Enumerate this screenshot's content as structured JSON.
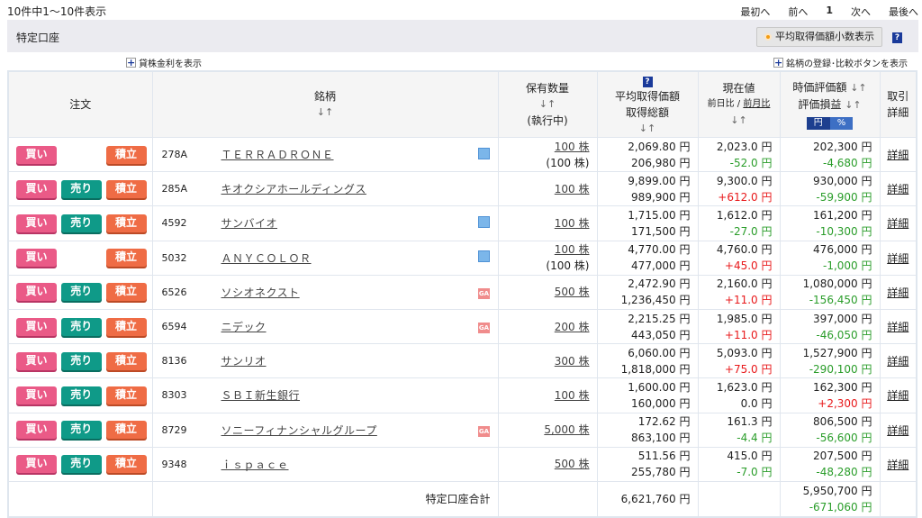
{
  "summary": "10件中1～10件表示",
  "pager": {
    "first": "最初へ",
    "prev": "前へ",
    "page": "1",
    "next": "次へ",
    "last": "最後へ"
  },
  "account_title": "特定口座",
  "avg_decimal_button": "平均取得価額小数表示",
  "help": "?",
  "show_lending": "貸株金利を表示",
  "show_compare": "銘柄の登録･比較ボタンを表示",
  "headers": {
    "order": "注文",
    "name": "銘柄",
    "qty": "保有数量",
    "qty_pending": "(執行中)",
    "avg": "平均取得価額",
    "total_cost": "取得総額",
    "price": "現在値",
    "day": "前日比",
    "month": "前月比",
    "value": "時価評価額",
    "pl": "評価損益",
    "yen": "円",
    "pct": "%",
    "detail1": "取引",
    "detail2": "詳細",
    "sort": "↓↑"
  },
  "buttons": {
    "buy": "買い",
    "sell": "売り",
    "accum": "積立"
  },
  "detail_link": "詳細",
  "rows": [
    {
      "code": "278A",
      "name": "ＴＥＲＲＡＤＲＯＮＥ",
      "icon": "calendar-icon",
      "sell": false,
      "qty": "100 株",
      "pending": "(100 株)",
      "avg": "2,069.80 円",
      "cost": "206,980 円",
      "price": "2,023.0 円",
      "chg": "-52.0 円",
      "value": "202,300 円",
      "pl": "-4,680 円"
    },
    {
      "code": "285A",
      "name": "キオクシアホールディングス",
      "icon": "",
      "sell": true,
      "qty": "100 株",
      "pending": "",
      "avg": "9,899.00 円",
      "cost": "989,900 円",
      "price": "9,300.0 円",
      "chg": "+612.0 円",
      "value": "930,000 円",
      "pl": "-59,900 円"
    },
    {
      "code": "4592",
      "name": "サンバイオ",
      "icon": "calendar-icon",
      "sell": true,
      "qty": "100 株",
      "pending": "",
      "avg": "1,715.00 円",
      "cost": "171,500 円",
      "price": "1,612.0 円",
      "chg": "-27.0 円",
      "value": "161,200 円",
      "pl": "-10,300 円"
    },
    {
      "code": "5032",
      "name": "ＡＮＹＣＯＬＯＲ",
      "icon": "calendar-icon",
      "sell": false,
      "qty": "100 株",
      "pending": "(100 株)",
      "avg": "4,770.00 円",
      "cost": "477,000 円",
      "price": "4,760.0 円",
      "chg": "+45.0 円",
      "value": "476,000 円",
      "pl": "-1,000 円"
    },
    {
      "code": "6526",
      "name": "ソシオネクスト",
      "icon": "ga-icon",
      "sell": true,
      "qty": "500 株",
      "pending": "",
      "avg": "2,472.90 円",
      "cost": "1,236,450 円",
      "price": "2,160.0 円",
      "chg": "+11.0 円",
      "value": "1,080,000 円",
      "pl": "-156,450 円"
    },
    {
      "code": "6594",
      "name": "ニデック",
      "icon": "ga-icon",
      "sell": true,
      "qty": "200 株",
      "pending": "",
      "avg": "2,215.25 円",
      "cost": "443,050 円",
      "price": "1,985.0 円",
      "chg": "+11.0 円",
      "value": "397,000 円",
      "pl": "-46,050 円"
    },
    {
      "code": "8136",
      "name": "サンリオ",
      "icon": "",
      "sell": true,
      "qty": "300 株",
      "pending": "",
      "avg": "6,060.00 円",
      "cost": "1,818,000 円",
      "price": "5,093.0 円",
      "chg": "+75.0 円",
      "value": "1,527,900 円",
      "pl": "-290,100 円"
    },
    {
      "code": "8303",
      "name": "ＳＢＩ新生銀行",
      "icon": "",
      "sell": true,
      "qty": "100 株",
      "pending": "",
      "avg": "1,600.00 円",
      "cost": "160,000 円",
      "price": "1,623.0 円",
      "chg": "0.0 円",
      "value": "162,300 円",
      "pl": "+2,300 円"
    },
    {
      "code": "8729",
      "name": "ソニーフィナンシャルグループ",
      "icon": "ga-icon",
      "sell": true,
      "qty": "5,000 株",
      "pending": "",
      "avg": "172.62 円",
      "cost": "863,100 円",
      "price": "161.3 円",
      "chg": "-4.4 円",
      "value": "806,500 円",
      "pl": "-56,600 円"
    },
    {
      "code": "9348",
      "name": "ｉｓｐａｃｅ",
      "icon": "",
      "sell": true,
      "qty": "500 株",
      "pending": "",
      "avg": "511.56 円",
      "cost": "255,780 円",
      "price": "415.0 円",
      "chg": "-7.0 円",
      "value": "207,500 円",
      "pl": "-48,280 円"
    }
  ],
  "total": {
    "label": "特定口座合計",
    "cost": "6,621,760 円",
    "value": "5,950,700 円",
    "pl": "-671,060 円"
  },
  "colors": {
    "up": "#e8191b",
    "down": "#2a9d2a"
  }
}
